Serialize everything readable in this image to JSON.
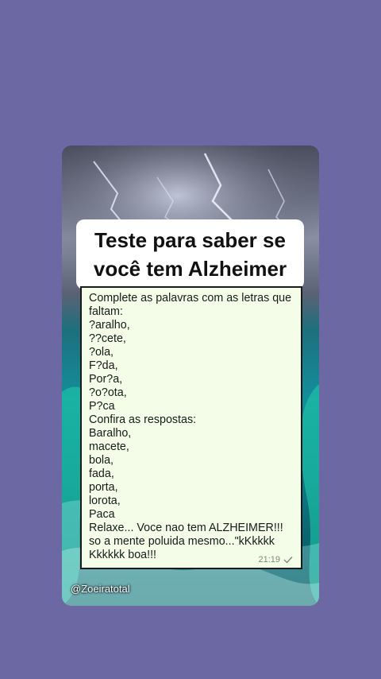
{
  "post": {
    "title": "Teste para saber se\nvocê tem Alzheimer",
    "message": "Complete as palavras com as letras que faltam:\n?aralho,\n??cete,\n?ola,\nF?da,\nPor?a,\n?o?ota,\nP?ca\nConfira as respostas:\nBaralho,\nmacete,\nbola,\nfada,\nporta,\nlorota,\nPaca\nRelaxe... Voce nao tem ALZHEIMER!!! so a mente poluida mesmo...\"kKkkkk Kkkkkk boa!!!",
    "time": "21:19",
    "status_icon": "single-check-icon",
    "watermark": "@Zoeiratotal"
  },
  "colors": {
    "page_background": "#6b68a3",
    "bubble_background": "#f4fde7",
    "title_background": "#ffffff"
  }
}
